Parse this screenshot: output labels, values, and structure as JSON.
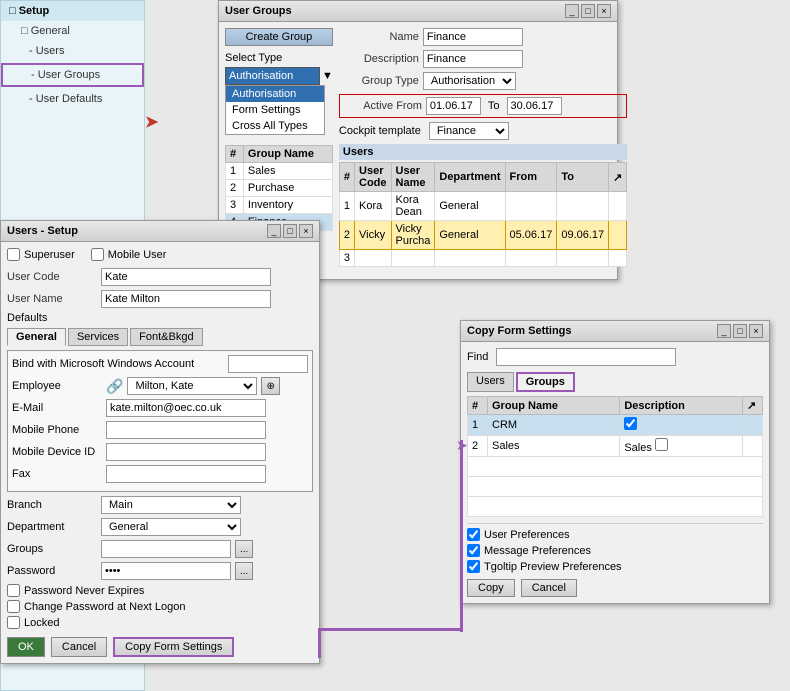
{
  "sidebar": {
    "title": "Setup",
    "items": [
      {
        "label": "Setup",
        "level": 0,
        "type": "section"
      },
      {
        "label": "General",
        "level": 1,
        "type": "folder"
      },
      {
        "label": "Users",
        "level": 2,
        "type": "item"
      },
      {
        "label": "User Groups",
        "level": 2,
        "type": "item",
        "active": true
      },
      {
        "label": "User Defaults",
        "level": 2,
        "type": "item"
      }
    ]
  },
  "user_groups_window": {
    "title": "User Groups",
    "create_group_btn": "Create Group",
    "select_type_label": "Select Type",
    "select_type_value": "Authorisation",
    "select_type_options": [
      "Authorisation",
      "Form Settings",
      "Cross All Types"
    ],
    "name_label": "Name",
    "name_value": "Finance",
    "description_label": "Description",
    "description_value": "Finance",
    "group_type_label": "Group Type",
    "group_type_value": "Authorisation",
    "active_from_label": "Active From",
    "active_from_value": "01.06.17",
    "to_label": "To",
    "to_value": "30.06.17",
    "cockpit_label": "Cockpit template",
    "cockpit_value": "Finance",
    "groups_table": {
      "headers": [
        "#",
        "Group Name"
      ],
      "rows": [
        {
          "num": "1",
          "name": "Sales"
        },
        {
          "num": "2",
          "name": "Purchase"
        },
        {
          "num": "3",
          "name": "Inventory"
        },
        {
          "num": "4",
          "name": "Finance",
          "selected": true
        }
      ]
    },
    "users_section": "Users",
    "users_table": {
      "headers": [
        "#",
        "User Code",
        "User Name",
        "Department",
        "From",
        "To"
      ],
      "rows": [
        {
          "num": "1",
          "code": "Kora",
          "name": "Kora Dean",
          "dept": "General",
          "from": "",
          "to": ""
        },
        {
          "num": "2",
          "code": "Vicky",
          "name": "Vicky Purcha",
          "dept": "General",
          "from": "05.06.17",
          "to": "09.06.17",
          "highlighted": true
        },
        {
          "num": "3",
          "code": "",
          "name": "",
          "dept": "",
          "from": "",
          "to": ""
        }
      ]
    }
  },
  "users_setup_window": {
    "title": "Users - Setup",
    "superuser_label": "Superuser",
    "mobile_user_label": "Mobile User",
    "user_code_label": "User Code",
    "user_code_value": "Kate",
    "user_name_label": "User Name",
    "user_name_value": "Kate Milton",
    "defaults_label": "Defaults",
    "tabs": [
      "General",
      "Services",
      "Font&Bkgd"
    ],
    "active_tab": "General",
    "bind_ms_label": "Bind with Microsoft Windows Account",
    "employee_label": "Employee",
    "employee_value": "Milton, Kate",
    "email_label": "E-Mail",
    "email_value": "kate.milton@oec.co.uk",
    "mobile_phone_label": "Mobile Phone",
    "mobile_device_id_label": "Mobile Device ID",
    "fax_label": "Fax",
    "branch_label": "Branch",
    "branch_value": "Main",
    "department_label": "Department",
    "department_value": "General",
    "groups_label": "Groups",
    "password_label": "Password",
    "password_value": "****",
    "password_never_expires": "Password Never Expires",
    "change_password": "Change Password at Next Logon",
    "locked": "Locked",
    "ok_btn": "OK",
    "cancel_btn": "Cancel",
    "copy_form_settings_btn": "Copy Form Settings"
  },
  "copy_form_settings_window": {
    "title": "Copy Form Settings",
    "find_label": "Find",
    "tabs": [
      "Users",
      "Groups"
    ],
    "active_tab": "Groups",
    "table": {
      "headers": [
        "#",
        "Group Name",
        "Description"
      ],
      "rows": [
        {
          "num": "1",
          "name": "CRM",
          "desc": "",
          "selected": true,
          "checked": true
        },
        {
          "num": "2",
          "name": "Sales",
          "desc": "Sales",
          "selected": false,
          "checked": false
        }
      ]
    },
    "checkboxes": [
      {
        "label": "User Preferences",
        "checked": true
      },
      {
        "label": "Message Preferences",
        "checked": true
      },
      {
        "label": "Tgoltip Preview Preferences",
        "checked": true
      }
    ],
    "copy_btn": "Copy",
    "cancel_btn": "Cancel"
  }
}
